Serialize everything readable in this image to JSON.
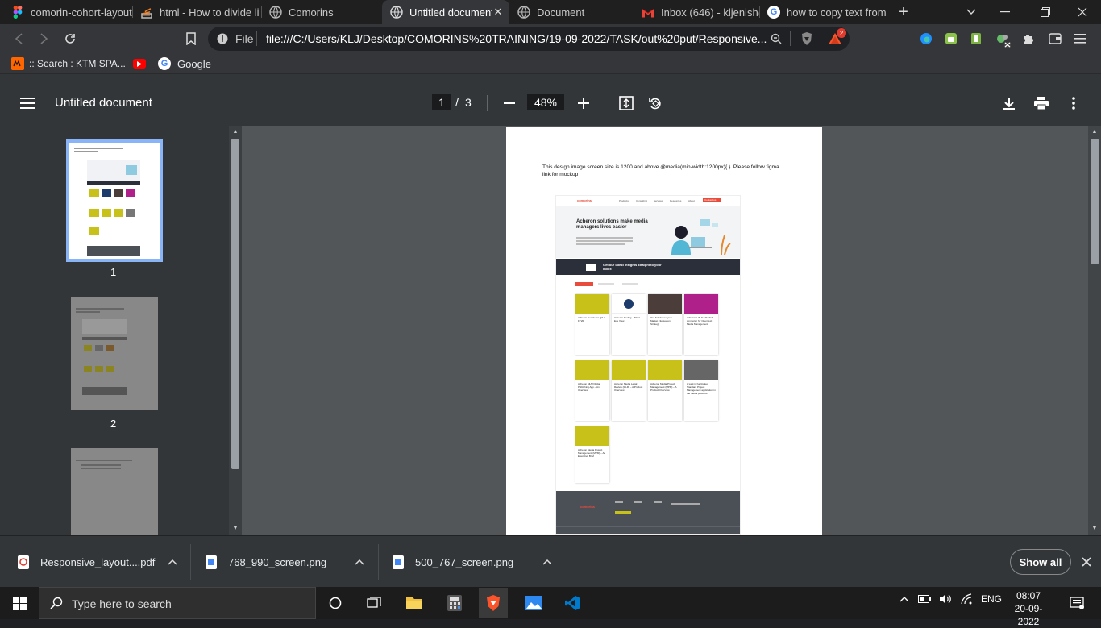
{
  "tabs": [
    {
      "title": "comorin-cohort-layout",
      "icon": "figma-icon",
      "active": false
    },
    {
      "title": "html - How to divide li",
      "icon": "stackoverflow-icon",
      "active": false
    },
    {
      "title": "Comorins",
      "icon": "globe-icon",
      "active": false
    },
    {
      "title": "Untitled document",
      "icon": "globe-icon",
      "active": true
    },
    {
      "title": "Document",
      "icon": "globe-icon",
      "active": false
    },
    {
      "title": "Inbox (646) - kljenish@",
      "icon": "gmail-icon",
      "active": false
    },
    {
      "title": "how to copy text from",
      "icon": "google-icon",
      "active": false
    }
  ],
  "tab_close": "✕",
  "new_tab": "+",
  "address": {
    "scheme_label": "File",
    "url": "file:///C:/Users/KLJ/Desktop/COMORINS%20TRAINING/19-09-2022/TASK/out%20put/Responsive...",
    "brave_badge": "2"
  },
  "bookmarks": [
    {
      "label": ":: Search : KTM SPA...",
      "icon": "ktm-icon"
    },
    {
      "label": "",
      "icon": "youtube-icon"
    },
    {
      "label": "Google",
      "icon": "google-icon"
    }
  ],
  "pdf": {
    "title": "Untitled document",
    "page_current": "1",
    "page_sep": "/",
    "page_total": "3",
    "zoom": "48%",
    "thumb_labels": [
      "1",
      "2"
    ],
    "page_heading": "This design image screen size is 1200 and above @media(min-width:1200px){ }. Please follow figma link for mockup"
  },
  "mockup": {
    "logo": "comorins",
    "nav": [
      "Products",
      "Consulting",
      "Services",
      "Resources",
      "About"
    ],
    "cta": "Contact us",
    "hero_title": "Acheron solutions make media managers lives easier",
    "newsletter": "Get our latest insights straight to your inbox",
    "card_titles": [
      "Acheron Newsletter Q3 / FY20",
      "Acheron Tooling – Third-Eye View",
      "Our Solution to your Market Fluctuation Strategy",
      "Acheron's IN-NJ Publish connector for OpenText Media Management",
      "Acheron MLM Digital Publishing App – An Overview",
      "Acheron Media Legal Review (MLR) – A Product Overview",
      "Acheron Media Project Management (MPM) – A Product Overview",
      "A walk in half-baked Standard Project Management application in the media products",
      "Acheron Media Project Management (MPM) – An Executive Brief"
    ],
    "footer_logo": "comorins"
  },
  "downloads": [
    {
      "name": "Responsive_layout....pdf",
      "icon": "pdf-file-icon"
    },
    {
      "name": "768_990_screen.png",
      "icon": "image-file-icon"
    },
    {
      "name": "500_767_screen.png",
      "icon": "image-file-icon"
    }
  ],
  "downloads_show_all": "Show all",
  "taskbar": {
    "search_placeholder": "Type here to search",
    "lang": "ENG",
    "time": "08:07",
    "date": "20-09-2022"
  },
  "colors": {
    "accent_red": "#e84c3d",
    "brave_orange": "#fb542b",
    "mock_yellow": "#c8c11a",
    "mock_dark": "#2b2f3a"
  }
}
